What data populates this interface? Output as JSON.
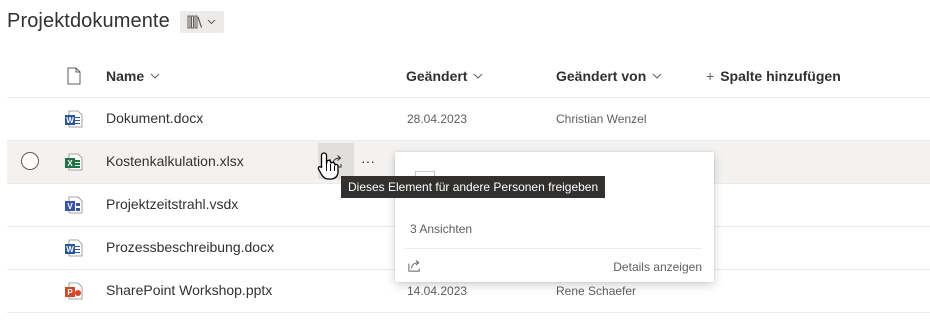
{
  "library": {
    "title": "Projektdokumente",
    "view_icon": "library-books-icon"
  },
  "columns": {
    "name": "Name",
    "modified": "Geändert",
    "modified_by": "Geändert von",
    "add_column": "Spalte hinzufügen"
  },
  "rows": [
    {
      "name": "Dokument.docx",
      "type": "word",
      "modified": "28.04.2023",
      "modified_by": "Christian Wenzel"
    },
    {
      "name": "Kostenkalkulation.xlsx",
      "type": "excel",
      "modified": "",
      "modified_by": ""
    },
    {
      "name": "Projektzeitstrahl.vsdx",
      "type": "visio",
      "modified": "",
      "modified_by": ""
    },
    {
      "name": "Prozessbeschreibung.docx",
      "type": "word",
      "modified": "",
      "modified_by": ""
    },
    {
      "name": "SharePoint Workshop.pptx",
      "type": "powerpoint",
      "modified": "14.04.2023",
      "modified_by": "Rene Schaefer"
    }
  ],
  "row_actions": {
    "share_icon": "share-icon",
    "more": "···"
  },
  "tooltip": {
    "text": "Dieses Element für andere Personen freigeben"
  },
  "hovercard": {
    "views": "3 Ansichten",
    "details_link": "Details anzeigen"
  },
  "colors": {
    "word": "#2b579a",
    "excel": "#217346",
    "visio": "#3955a3",
    "powerpoint": "#d24726",
    "selected_row": "#f3f2f1",
    "tooltip_bg": "#323130"
  }
}
